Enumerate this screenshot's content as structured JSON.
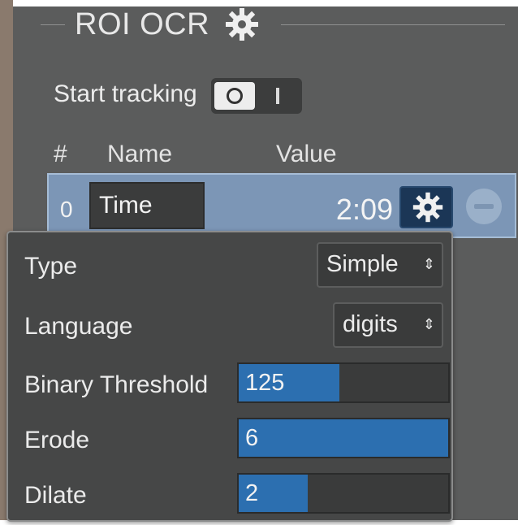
{
  "header": {
    "title": "ROI OCR",
    "settings_icon": "gear-icon"
  },
  "tracking": {
    "label": "Start tracking",
    "toggle_icon": "record-icon"
  },
  "table": {
    "columns": [
      "#",
      "Name",
      "Value"
    ],
    "rows": [
      {
        "index": "0",
        "name": "Time",
        "value": "2:09",
        "settings_icon": "gear-icon",
        "remove_icon": "minus-circle-icon"
      }
    ]
  },
  "popup": {
    "type": {
      "label": "Type",
      "selected": "Simple"
    },
    "language": {
      "label": "Language",
      "selected": "digits"
    },
    "binary_threshold": {
      "label": "Binary Threshold",
      "value": "125",
      "level": 0.48
    },
    "erode": {
      "label": "Erode",
      "value": "6",
      "level": 1.0
    },
    "dilate": {
      "label": "Dilate",
      "value": "2",
      "level": 0.33
    }
  },
  "colors": {
    "panel_bg": "#5b5c5c",
    "selected_row": "#7c96b6",
    "slider_fill": "#2c6fb0",
    "popup_bg": "#464747"
  }
}
